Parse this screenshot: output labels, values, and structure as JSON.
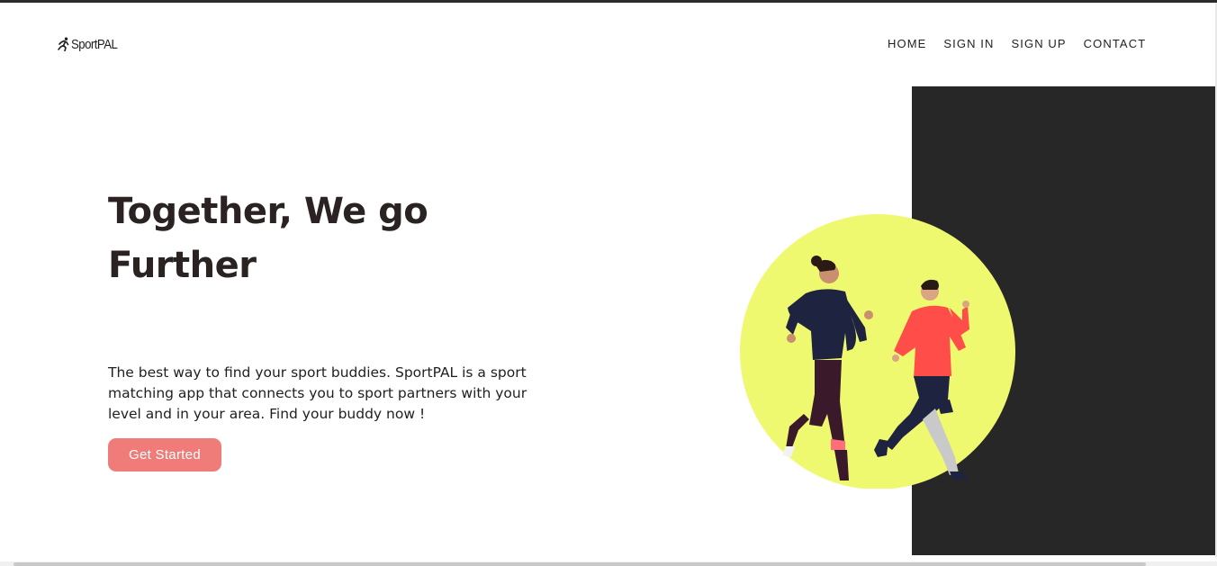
{
  "brand": {
    "logo_text": "SportPAL",
    "logo_icon": "runner-icon"
  },
  "nav": {
    "items": [
      {
        "label": "HOME"
      },
      {
        "label": "SIGN IN"
      },
      {
        "label": "SIGN UP"
      },
      {
        "label": "CONTACT"
      }
    ]
  },
  "hero": {
    "title": "Together, We go Further",
    "description": "The best way to find your sport buddies. SportPAL is a sport matching app that connects you to sport partners with your level and in your area. Find your buddy now !",
    "cta_label": "Get Started",
    "image": "two-women-running-illustration"
  },
  "colors": {
    "accent": "#f07c79",
    "panel": "#272727",
    "circle": "#eff96f",
    "text": "#2a2322"
  }
}
